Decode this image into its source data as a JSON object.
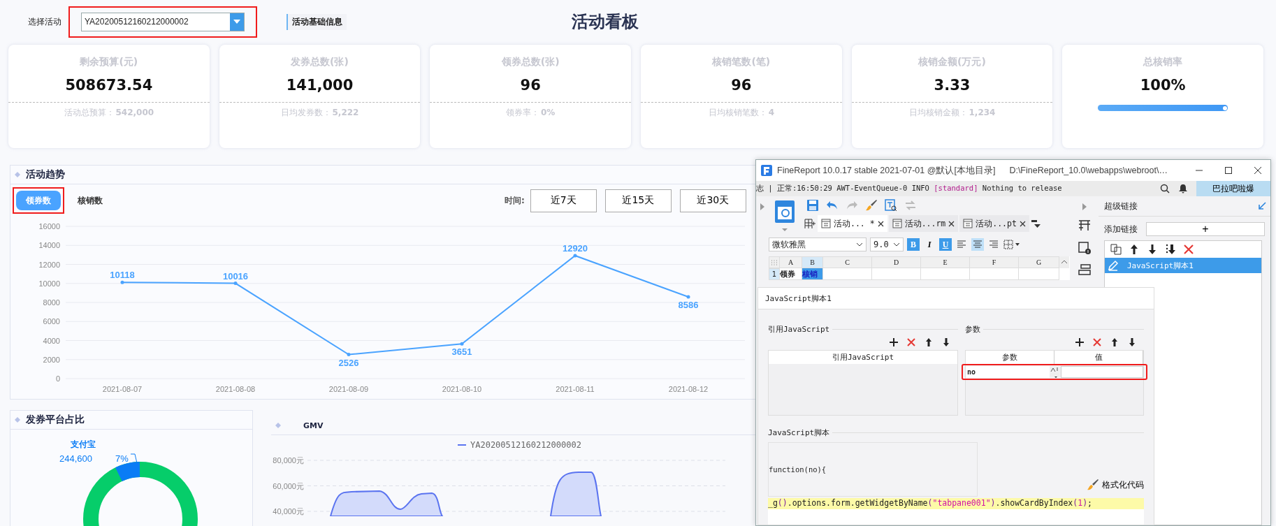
{
  "filter": {
    "label": "选择活动",
    "value": "YA20200512160212000002",
    "highlighted": true
  },
  "info_tab": "活动基础信息",
  "title": "活动看板",
  "cards": [
    {
      "kind": "stat",
      "label": "剩余预算(元)",
      "value": "508673.54",
      "sub_label": "活动总预算：",
      "sub_value": "542,000"
    },
    {
      "kind": "stat",
      "label": "发券总数(张)",
      "value": "141,000",
      "sub_label": "日均发券数：",
      "sub_value": "5,222"
    },
    {
      "kind": "stat",
      "label": "领券总数(张)",
      "value": "96",
      "sub_label": "领券率：",
      "sub_value": "0%"
    },
    {
      "kind": "stat",
      "label": "核销笔数(笔)",
      "value": "96",
      "sub_label": "日均核销笔数：",
      "sub_value": "4"
    },
    {
      "kind": "stat",
      "label": "核销金额(万元)",
      "value": "3.33",
      "sub_label": "日均核销金额：",
      "sub_value": "1,234"
    },
    {
      "kind": "progress",
      "label": "总核销率",
      "value": "100%",
      "level": 1
    }
  ],
  "trend": {
    "title": "活动趋势",
    "tabs": [
      {
        "label": "领券数",
        "selected": true,
        "highlighted": true
      },
      {
        "label": "核销数",
        "selected": false,
        "highlighted": false
      }
    ],
    "time_label": "时间:",
    "ranges": [
      "近7天",
      "近15天",
      "近30天"
    ],
    "chart_data": {
      "type": "line",
      "categories": [
        "2021-08-07",
        "2021-08-08",
        "2021-08-09",
        "2021-08-10",
        "2021-08-11",
        "2021-08-12"
      ],
      "values": [
        10118,
        10016,
        2526,
        3651,
        12920,
        8586
      ],
      "grid": true,
      "ylim": [
        0,
        16000
      ],
      "yticks": [
        0,
        2000,
        4000,
        6000,
        8000,
        10000,
        12000,
        14000,
        16000
      ],
      "data_labels": true
    }
  },
  "platform": {
    "title": "发券平台占比",
    "slice_name": "支付宝",
    "slice_value": "244,600",
    "slice_percent": "7%"
  },
  "gmv": {
    "title": "GMV",
    "legend": "YA20200512160212000002",
    "y_labels": [
      "80,000元",
      "60,000元",
      "40,000元"
    ]
  },
  "designer": {
    "title": "FineReport 10.0.17 stable 2021-07-01 @默认[本地目录]",
    "path": "D:\\FineReport_10.0\\webapps\\webroot\\…",
    "log": {
      "text": "志 | 正常:16:50:29 AWT-EventQueue-0 INFO ",
      "tag": "[standard]",
      "message": " Nothing to release"
    },
    "user": "巴拉吧啦爆",
    "file_tabs": [
      {
        "label": "活动... *",
        "selected": true
      },
      {
        "label": "活动...rm",
        "selected": false
      },
      {
        "label": "活动...pt",
        "selected": false
      }
    ],
    "font": "微软雅黑",
    "font_size": "9.0",
    "styles": [
      {
        "label": "B",
        "on": true
      },
      {
        "label": "I",
        "on": false
      },
      {
        "label": "U",
        "on": true
      }
    ],
    "align": [
      {
        "selected": false
      },
      {
        "selected": true
      },
      {
        "selected": false
      }
    ],
    "columns": [
      {
        "label": "A",
        "selected": false
      },
      {
        "label": "B",
        "selected": true
      },
      {
        "label": "C",
        "selected": false
      },
      {
        "label": "D",
        "selected": false
      },
      {
        "label": "E",
        "selected": false
      },
      {
        "label": "F",
        "selected": false
      },
      {
        "label": "G",
        "selected": false
      }
    ],
    "rows": [
      {
        "label": "1",
        "selected": true,
        "cells": [
          {
            "text": "领券",
            "selected": false
          },
          {
            "text": "核销",
            "selected": true
          }
        ]
      }
    ],
    "panel": {
      "title": "超级链接",
      "add_label": "添加链接",
      "add_button": "+",
      "links": [
        {
          "label": "JavaScript脚本1",
          "selected": true
        }
      ]
    },
    "dialog": {
      "title": "JavaScript脚本1",
      "ref_section": "引用JavaScript",
      "ref_column": "引用JavaScript",
      "param_section": "参数",
      "param_columns": [
        "参数",
        "值"
      ],
      "params": [
        {
          "name": "no",
          "highlighted": true
        }
      ],
      "script_section": "JavaScript脚本",
      "code": [
        {
          "text": "function(no){",
          "current": false
        },
        {
          "text": "_g().options.form.getWidgetByName(\"tabpane001\").showCardByIndex(1);",
          "current": true
        }
      ],
      "format_button": "格式化代码"
    }
  }
}
